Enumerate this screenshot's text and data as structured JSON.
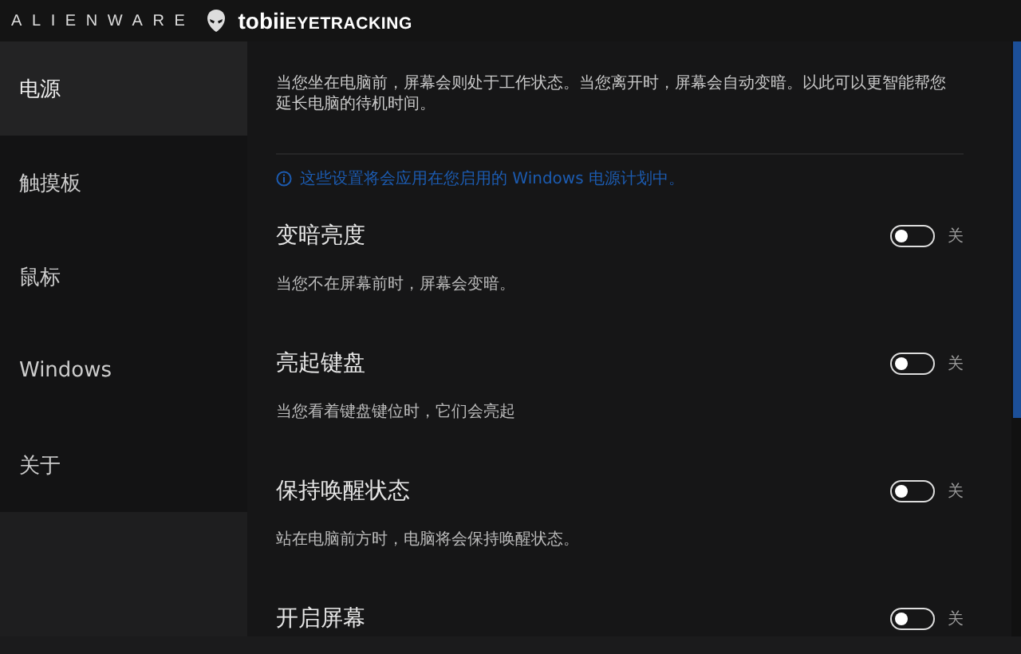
{
  "header": {
    "brand": "ALIENWARE",
    "product_brand": "tobii",
    "product_suffix": "EYETRACKING"
  },
  "sidebar": {
    "items": [
      {
        "label": "电源",
        "selected": true
      },
      {
        "label": "触摸板",
        "selected": false
      },
      {
        "label": "鼠标",
        "selected": false
      },
      {
        "label": "Windows",
        "selected": false
      },
      {
        "label": "关于",
        "selected": false
      }
    ]
  },
  "intro": "当您坐在电脑前，屏幕会则处于工作状态。当您离开时，屏幕会自动变暗。以此可以更智能帮您延长电脑的待机时间。",
  "info_note": "这些设置将会应用在您启用的 Windows 电源计划中。",
  "settings": [
    {
      "title": "变暗亮度",
      "description": "当您不在屏幕前时，屏幕会变暗。",
      "on": false,
      "state_label": "关"
    },
    {
      "title": "亮起键盘",
      "description": "当您看着键盘键位时，它们会亮起",
      "on": false,
      "state_label": "关"
    },
    {
      "title": "保持唤醒状态",
      "description": "站在电脑前方时，电脑将会保持唤醒状态。",
      "on": false,
      "state_label": "关"
    },
    {
      "title": "开启屏幕",
      "on": false,
      "state_label": "关"
    }
  ]
}
